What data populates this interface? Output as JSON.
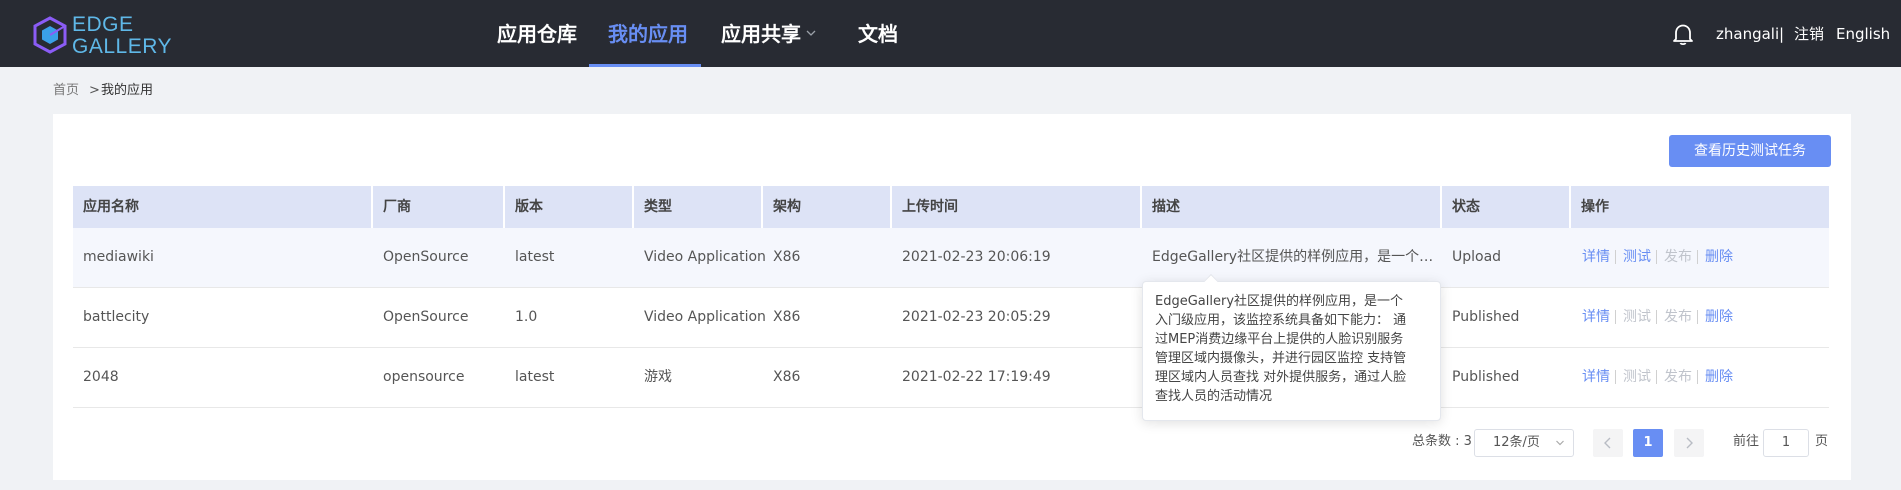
{
  "header": {
    "logo_text_line1": "EDGE",
    "logo_text_line2": "GALLERY",
    "nav": [
      {
        "label": "应用仓库"
      },
      {
        "label": "我的应用"
      },
      {
        "label": "应用共享"
      },
      {
        "label": "文档"
      }
    ],
    "active_nav": "我的应用",
    "username": "zhangali",
    "separator": "|",
    "logout": "注销",
    "language": "English"
  },
  "breadcrumb": {
    "home": "首页",
    "separator": ">",
    "current": "我的应用"
  },
  "toolbar": {
    "history_button": "查看历史测试任务"
  },
  "table": {
    "columns": [
      "应用名称",
      "厂商",
      "版本",
      "类型",
      "架构",
      "上传时间",
      "描述",
      "状态",
      "操作"
    ],
    "rows": [
      {
        "name": "mediawiki",
        "vendor": "OpenSource",
        "version": "latest",
        "type": "Video Application",
        "arch": "X86",
        "upload_time": "2021-02-23 20:06:19",
        "description": "EdgeGallery社区提供的样例应用，是一个入门级应用，该监控系统具备如下能力",
        "status": "Upload",
        "ops": [
          {
            "label": "详情",
            "enabled": true
          },
          {
            "label": "测试",
            "enabled": true
          },
          {
            "label": "发布",
            "enabled": false
          },
          {
            "label": "删除",
            "enabled": true
          }
        ]
      },
      {
        "name": "battlecity",
        "vendor": "OpenSource",
        "version": "1.0",
        "type": "Video Application",
        "arch": "X86",
        "upload_time": "2021-02-23 20:05:29",
        "description": "",
        "status": "Published",
        "ops": [
          {
            "label": "详情",
            "enabled": true
          },
          {
            "label": "测试",
            "enabled": false
          },
          {
            "label": "发布",
            "enabled": false
          },
          {
            "label": "删除",
            "enabled": true
          }
        ]
      },
      {
        "name": "2048",
        "vendor": "opensource",
        "version": "latest",
        "type": "游戏",
        "arch": "X86",
        "upload_time": "2021-02-22 17:19:49",
        "description": "",
        "status": "Published",
        "ops": [
          {
            "label": "详情",
            "enabled": true
          },
          {
            "label": "测试",
            "enabled": false
          },
          {
            "label": "发布",
            "enabled": false
          },
          {
            "label": "删除",
            "enabled": true
          }
        ]
      }
    ]
  },
  "tooltip": {
    "lines": [
      "EdgeGallery社区提供的样例应用，是一个",
      "入门级应用，该监控系统具备如下能力： 通",
      "过MEP消费边缘平台上提供的人脸识别服务",
      "管理区域内摄像头，并进行园区监控 支持管",
      "理区域内人员查找 对外提供服务，通过人脸",
      "查找人员的活动情况"
    ]
  },
  "pagination": {
    "total_label": "总条数 : 3",
    "page_size": "12条/页",
    "current_page": "1",
    "goto_label": "前往",
    "goto_value": "1",
    "page_suffix": "页"
  },
  "colors": {
    "header_bg": "#282b33",
    "accent": "#688ef3",
    "table_header_bg": "#dde3f6",
    "disabled_op": "#c0c4cc"
  }
}
